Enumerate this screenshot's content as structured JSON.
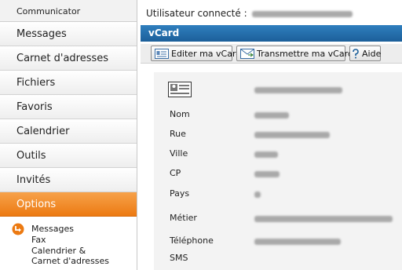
{
  "sidebar": {
    "header": "Communicator",
    "items": [
      {
        "label": "Messages"
      },
      {
        "label": "Carnet d'adresses"
      },
      {
        "label": "Fichiers"
      },
      {
        "label": "Favoris"
      },
      {
        "label": "Calendrier"
      },
      {
        "label": "Outils"
      },
      {
        "label": "Invités"
      },
      {
        "label": "Options"
      }
    ],
    "active_item": "Options",
    "subitems": [
      "Messages",
      "Fax",
      "Calendrier &",
      "Carnet d'adresses"
    ]
  },
  "header": {
    "user_label": "Utilisateur connecté :"
  },
  "vcard": {
    "title": "vCard",
    "buttons": {
      "edit": "Editer ma vCard",
      "send": "Transmettre ma vCard",
      "help": "Aide"
    },
    "fields": [
      {
        "label": "Nom"
      },
      {
        "label": "Rue"
      },
      {
        "label": "Ville"
      },
      {
        "label": "CP"
      },
      {
        "label": "Pays"
      },
      {
        "label": "Métier"
      },
      {
        "label": "Téléphone"
      },
      {
        "label": "SMS"
      }
    ]
  },
  "icons": {
    "submenu": "arrow-circle-icon",
    "edit": "vcard-edit-icon",
    "send": "vcard-send-icon",
    "help": "help-icon",
    "card": "vcard-icon"
  },
  "colors": {
    "accent_orange": "#ec7a12",
    "vcard_bar_blue": "#1c5f9a"
  }
}
